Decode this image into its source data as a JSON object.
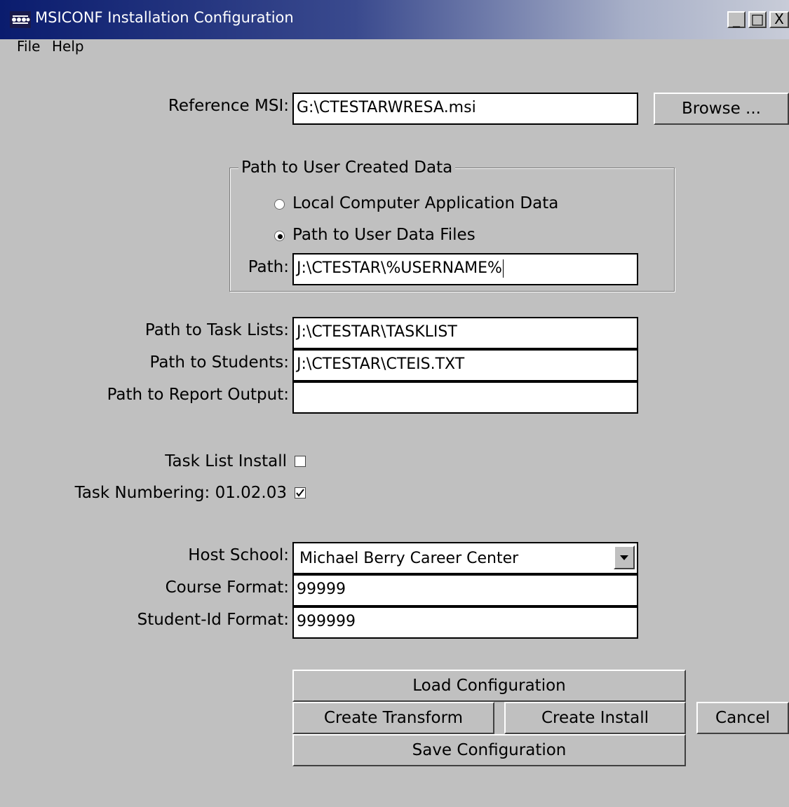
{
  "window": {
    "title": "MSICONF Installation Configuration",
    "controls": {
      "minimize": "_",
      "maximize": "□",
      "close": "X"
    }
  },
  "menu": {
    "file": "File",
    "help": "Help"
  },
  "form": {
    "reference_msi": {
      "label": "Reference MSI:",
      "value": "G:\\CTESTARWRESA.msi"
    },
    "browse_button": "Browse ...",
    "user_data_group": {
      "legend": "Path to User Created Data",
      "option_local": "Local Computer Application Data",
      "option_path": "Path to User Data Files",
      "selected": "Path to User Data Files",
      "path_label": "Path:",
      "path_value": "J:\\CTESTAR\\%USERNAME%"
    },
    "task_lists": {
      "label": "Path to Task Lists:",
      "value": "J:\\CTESTAR\\TASKLIST"
    },
    "students": {
      "label": "Path to Students:",
      "value": "J:\\CTESTAR\\CTEIS.TXT"
    },
    "report_output": {
      "label": "Path to Report Output:",
      "value": ""
    },
    "task_list_install": {
      "label": "Task List Install",
      "checked": false
    },
    "task_numbering": {
      "label": "Task Numbering: 01.02.03",
      "checked": true
    },
    "host_school": {
      "label": "Host School:",
      "value": "Michael Berry Career Center"
    },
    "course_format": {
      "label": "Course Format:",
      "value": "99999"
    },
    "student_id_format": {
      "label": "Student-Id Format:",
      "value": "999999"
    }
  },
  "buttons": {
    "load": "Load Configuration",
    "create_transform": "Create Transform",
    "create_install": "Create Install",
    "cancel": "Cancel",
    "save": "Save Configuration"
  },
  "colors": {
    "face": "#c0c0c0",
    "title_start": "#0a1c6e",
    "title_end": "#c8ccd8"
  }
}
